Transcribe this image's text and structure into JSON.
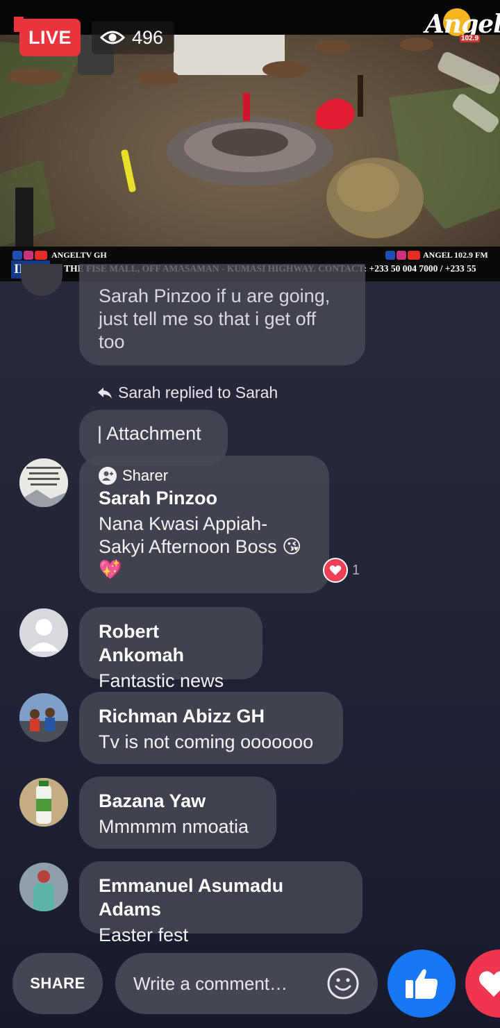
{
  "live": {
    "badge": "LIVE",
    "viewer_count": "496"
  },
  "channel_logo": {
    "brand_text": "Angel",
    "frequency": "102.9"
  },
  "ticker": {
    "left_handle": "ANGELTV GH",
    "right_handle": "ANGEL 102.9 FM",
    "label": "INFO",
    "scroll_text": "E THE FISE MALL, OFF AMASAMAN - KUMASI HIGHWAY. CONTACT: +233 50 004 7000 / +233 55"
  },
  "comments": {
    "partial": {
      "text": "Sarah Pinzoo if u are going, just tell me so that i get off too"
    },
    "reply_indicator": "Sarah replied to Sarah",
    "attachment": {
      "text": "| Attachment"
    },
    "sharer_comment": {
      "badge_label": "Sharer",
      "name": "Sarah Pinzoo",
      "text": "Nana Kwasi Appiah-Sakyi Afternoon Boss 😘💖",
      "reaction_count": "1"
    },
    "items": [
      {
        "name": "Robert Ankomah",
        "text": "Fantastic  news"
      },
      {
        "name": "Richman Abizz GH",
        "text": "Tv is not coming ooooooo"
      },
      {
        "name": "Bazana Yaw",
        "text": "Mmmmm nmoatia"
      },
      {
        "name": "Emmanuel Asumadu Adams",
        "text": "Easter fest"
      }
    ]
  },
  "bottom_bar": {
    "share_label": "SHARE",
    "comment_placeholder": "Write a comment…"
  },
  "colors": {
    "live_red": "#e9343e",
    "like_blue": "#1877f2",
    "love_red": "#f0364e",
    "bubble_bg": "#484956"
  },
  "icons": [
    "eye-icon",
    "reply-arrow-icon",
    "sharer-badge-icon",
    "heart-reaction-icon",
    "emoji-icon",
    "like-thumb-icon",
    "love-heart-icon"
  ]
}
